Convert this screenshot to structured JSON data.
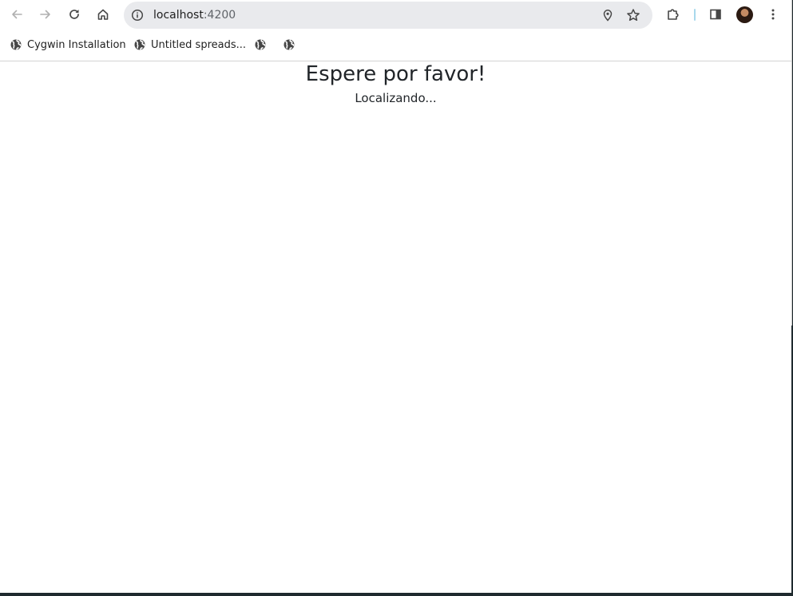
{
  "browser": {
    "url_host": "localhost",
    "url_port": ":4200",
    "colors": {
      "omnibox_bg": "#e9eaed",
      "icon": "#474747",
      "icon_disabled": "#b0b0b0",
      "divider": "#a8d8ec"
    },
    "icons": {
      "back": "arrow-left-icon",
      "forward": "arrow-right-icon",
      "reload": "reload-icon",
      "home": "home-icon",
      "site_info": "info-icon",
      "location": "location-pin-icon",
      "bookmark": "star-icon",
      "extensions": "puzzle-icon",
      "side_panel": "side-panel-icon",
      "menu": "kebab-menu-icon"
    }
  },
  "bookmarks": {
    "items": [
      {
        "label": "Cygwin Installation",
        "icon": "globe-icon"
      },
      {
        "label": "Untitled spreads...",
        "icon": "globe-icon"
      },
      {
        "label": "",
        "icon": "globe-icon"
      },
      {
        "label": "",
        "icon": "globe-icon"
      }
    ]
  },
  "page": {
    "title": "Espere por favor!",
    "subtitle": "Localizando..."
  }
}
